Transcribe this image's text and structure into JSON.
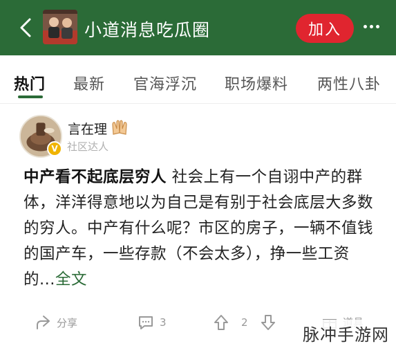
{
  "header": {
    "title": "小道消息吃瓜圈",
    "join_label": "加入",
    "colors": {
      "bar": "#2b6b37",
      "join": "#e0252f"
    }
  },
  "tabs": [
    {
      "label": "热门",
      "active": true
    },
    {
      "label": "最新",
      "active": false
    },
    {
      "label": "官海浮沉",
      "active": false
    },
    {
      "label": "职场爆料",
      "active": false
    },
    {
      "label": "两性八卦",
      "active": false
    }
  ],
  "post": {
    "author": "言在理",
    "author_tag": "社区达人",
    "badge": "V",
    "headline": "中产看不起底层穷人",
    "body": " 社会上有一个自诩中产的群体，洋洋得意地以为自己是有别于社会底层大多数的穷人。中产有什么呢？市区的房子，一辆不值钱的国产车，一些存款（不会太多），挣一些工资的...",
    "more_label": "全文",
    "actions": {
      "share_label": "分享",
      "comments": "3",
      "votes": "2",
      "props_label": "道具"
    }
  },
  "watermark": "脉冲手游网",
  "icons": [
    "back-arrow-icon",
    "more-dots-icon",
    "hands-emoji-icon",
    "share-icon",
    "comment-icon",
    "upvote-icon",
    "downvote-icon",
    "gift-icon"
  ]
}
